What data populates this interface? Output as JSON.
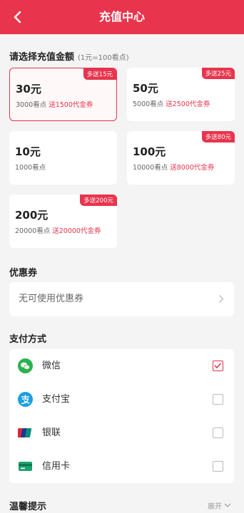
{
  "header": {
    "title": "充值中心"
  },
  "amount_section": {
    "title": "请选择充值金额",
    "hint": "(1元=100看点)"
  },
  "packages": [
    {
      "price": "30元",
      "points": "3000看点",
      "bonus": "送1500代金券",
      "badge": "多送15元",
      "selected": true
    },
    {
      "price": "50元",
      "points": "5000看点",
      "bonus": "送2500代金券",
      "badge": "多送25元",
      "selected": false
    },
    {
      "price": "10元",
      "points": "1000看点",
      "bonus": "",
      "badge": "",
      "selected": false
    },
    {
      "price": "100元",
      "points": "10000看点",
      "bonus": "送8000代金券",
      "badge": "多送80元",
      "selected": false
    },
    {
      "price": "200元",
      "points": "20000看点",
      "bonus": "送20000代金券",
      "badge": "多送200元",
      "selected": false
    }
  ],
  "coupon": {
    "title": "优惠券",
    "value": "无可使用优惠券"
  },
  "payment": {
    "title": "支付方式",
    "methods": [
      {
        "label": "微信",
        "icon": "wechat-icon",
        "checked": true
      },
      {
        "label": "支付宝",
        "icon": "alipay-icon",
        "checked": false
      },
      {
        "label": "银联",
        "icon": "unionpay-icon",
        "checked": false
      },
      {
        "label": "信用卡",
        "icon": "credit-card-icon",
        "checked": false
      }
    ]
  },
  "tips": {
    "title": "温馨提示",
    "expand_label": "展开"
  },
  "colors": {
    "accent": "#e8344c",
    "background": "#f4f4f4",
    "card": "#ffffff"
  }
}
